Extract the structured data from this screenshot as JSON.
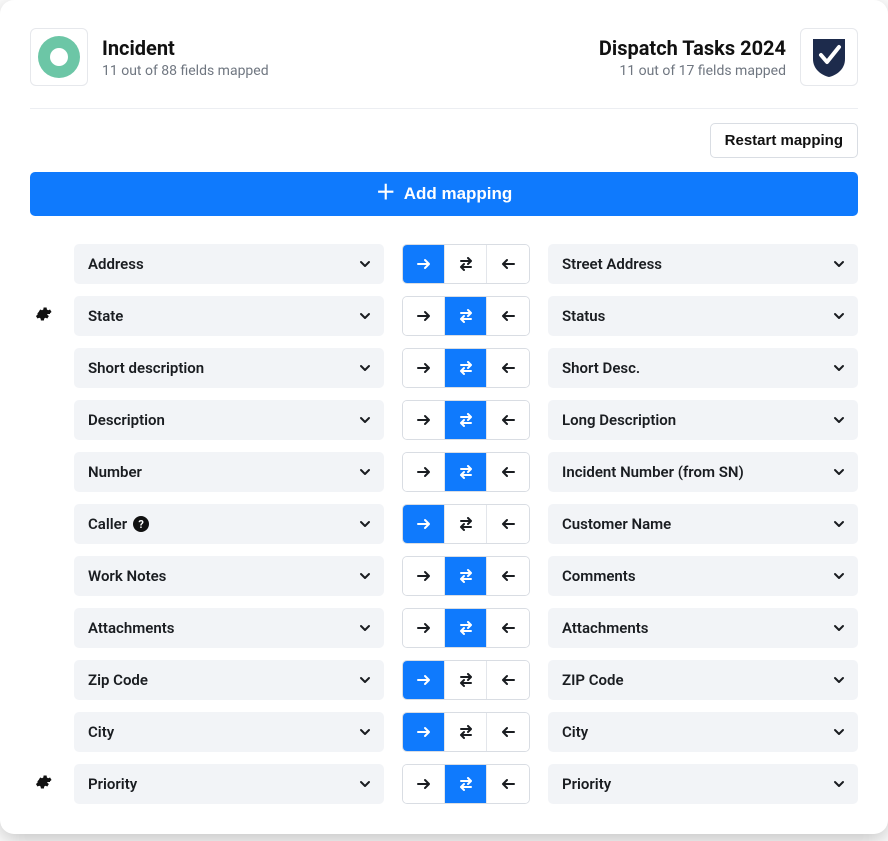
{
  "left": {
    "title": "Incident",
    "subtitle": "11 out of 88 fields mapped"
  },
  "right": {
    "title": "Dispatch Tasks 2024",
    "subtitle": "11 out of 17 fields mapped"
  },
  "toolbar": {
    "restart": "Restart mapping",
    "add": "Add mapping"
  },
  "mappings": [
    {
      "gear": false,
      "left": "Address",
      "info": false,
      "dir": "right",
      "right": "Street Address"
    },
    {
      "gear": true,
      "left": "State",
      "info": false,
      "dir": "both",
      "right": "Status"
    },
    {
      "gear": false,
      "left": "Short description",
      "info": false,
      "dir": "both",
      "right": "Short Desc."
    },
    {
      "gear": false,
      "left": "Description",
      "info": false,
      "dir": "both",
      "right": "Long Description"
    },
    {
      "gear": false,
      "left": "Number",
      "info": false,
      "dir": "both",
      "right": "Incident Number (from SN)"
    },
    {
      "gear": false,
      "left": "Caller",
      "info": true,
      "dir": "right",
      "right": "Customer Name"
    },
    {
      "gear": false,
      "left": "Work Notes",
      "info": false,
      "dir": "both",
      "right": "Comments"
    },
    {
      "gear": false,
      "left": "Attachments",
      "info": false,
      "dir": "both",
      "right": "Attachments"
    },
    {
      "gear": false,
      "left": "Zip Code",
      "info": false,
      "dir": "right",
      "right": "ZIP Code"
    },
    {
      "gear": false,
      "left": "City",
      "info": false,
      "dir": "right",
      "right": "City"
    },
    {
      "gear": true,
      "left": "Priority",
      "info": false,
      "dir": "both",
      "right": "Priority"
    }
  ]
}
